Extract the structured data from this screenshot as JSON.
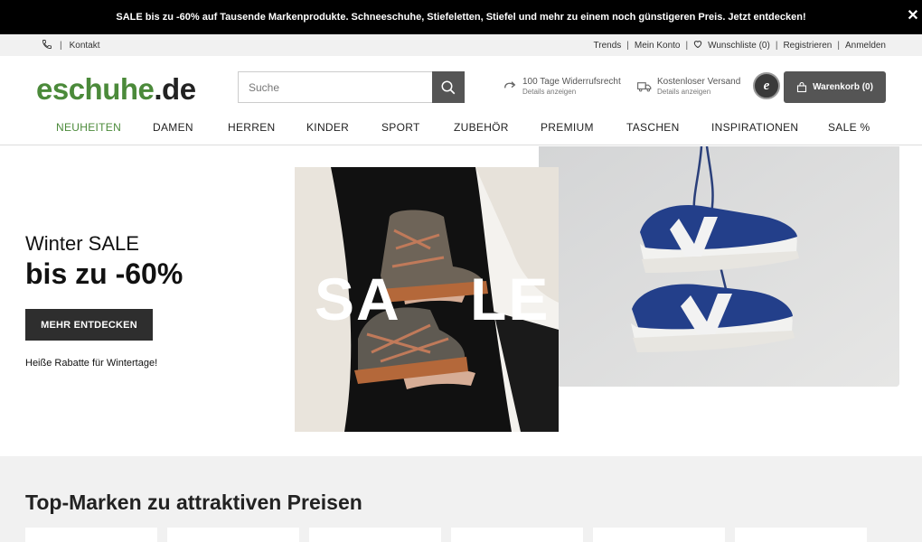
{
  "promo": {
    "text": "SALE bis zu -60% auf Tausende Markenprodukte. Schneeschuhe, Stiefeletten, Stiefel und mehr zu einem noch günstigeren Preis. Jetzt entdecken!",
    "close": "✕"
  },
  "servicebar": {
    "contact": "Kontakt",
    "separator": "|",
    "trends": "Trends",
    "account": "Mein Konto",
    "wishlist": "Wunschliste (0)",
    "register": "Registrieren",
    "login": "Anmelden"
  },
  "header": {
    "logo_part1": "eschuhe",
    "logo_part2": ".de",
    "search_placeholder": "Suche",
    "usp_return_title": "100 Tage Widerrufsrecht",
    "usp_return_sub": "Details anzeigen",
    "usp_shipping_title": "Kostenloser Versand",
    "usp_shipping_sub": "Details anzeigen",
    "trust_badge": "e",
    "cart_label": "Warenkorb (0)"
  },
  "nav": {
    "items": [
      "NEUHEITEN",
      "DAMEN",
      "HERREN",
      "KINDER",
      "SPORT",
      "ZUBEHÖR",
      "PREMIUM",
      "TASCHEN",
      "INSPIRATIONEN",
      "SALE %"
    ]
  },
  "hero": {
    "subtitle": "Winter SALE",
    "title": "bis zu -60%",
    "button": "MEHR ENTDECKEN",
    "note": "Heiße Rabatte für Wintertage!",
    "image_text_left": "SA",
    "image_text_right": "LE"
  },
  "brands": {
    "title": "Top-Marken zu attraktiven Preisen"
  },
  "colors": {
    "brand_green": "#4b8a3a",
    "dark_button": "#2e2e2e",
    "grey_button": "#555555"
  }
}
